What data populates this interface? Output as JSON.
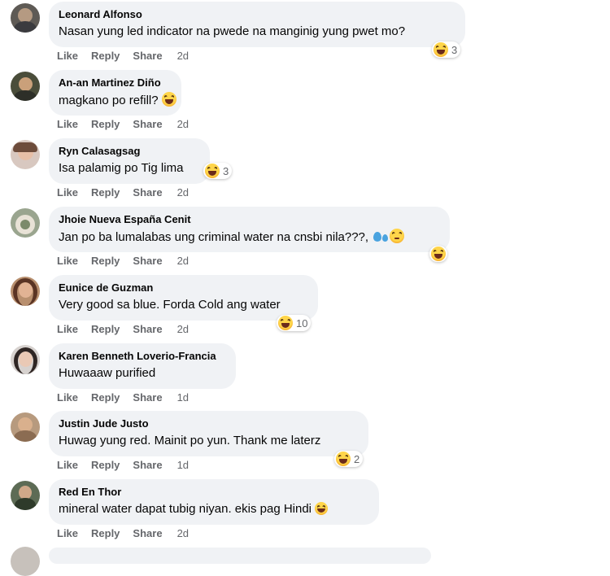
{
  "actions": {
    "like": "Like",
    "reply": "Reply",
    "share": "Share"
  },
  "comments": [
    {
      "name": "Leonard Alfonso",
      "text": "Nasan yung led indicator na pwede na manginig yung pwet mo?",
      "time": "2d",
      "reactions": "3",
      "reaction_icon": "haha-emoji-icon"
    },
    {
      "name": "An-an Martinez Diño",
      "text": "magkano po refill?",
      "time": "2d",
      "reaction_icon": "haha-emoji-icon"
    },
    {
      "name": "Ryn Calasagsag",
      "text": "Isa palamig po Tig lima",
      "time": "2d",
      "reactions": "3",
      "reaction_icon": "haha-emoji-icon"
    },
    {
      "name": "Jhoie Nueva España Cenit",
      "text": "Jan po ba lumalabas ung criminal water na cnsbi nila???,",
      "time": "2d",
      "reaction_icon": "haha-emoji-icon"
    },
    {
      "name": "Eunice de Guzman",
      "text": "Very good sa blue. Forda Cold ang water",
      "time": "2d",
      "reactions": "10",
      "reaction_icon": "haha-emoji-icon"
    },
    {
      "name": "Karen Benneth Loverio-Francia",
      "text": "Huwaaaw purified",
      "time": "1d"
    },
    {
      "name": "Justin Jude Justo",
      "text": "Huwag yung red. Mainit po yun. Thank me laterz",
      "time": "1d",
      "reactions": "2",
      "reaction_icon": "haha-emoji-icon"
    },
    {
      "name": "Red En Thor",
      "text": "mineral water dapat tubig niyan. ekis pag Hindi",
      "time": "2d"
    }
  ]
}
